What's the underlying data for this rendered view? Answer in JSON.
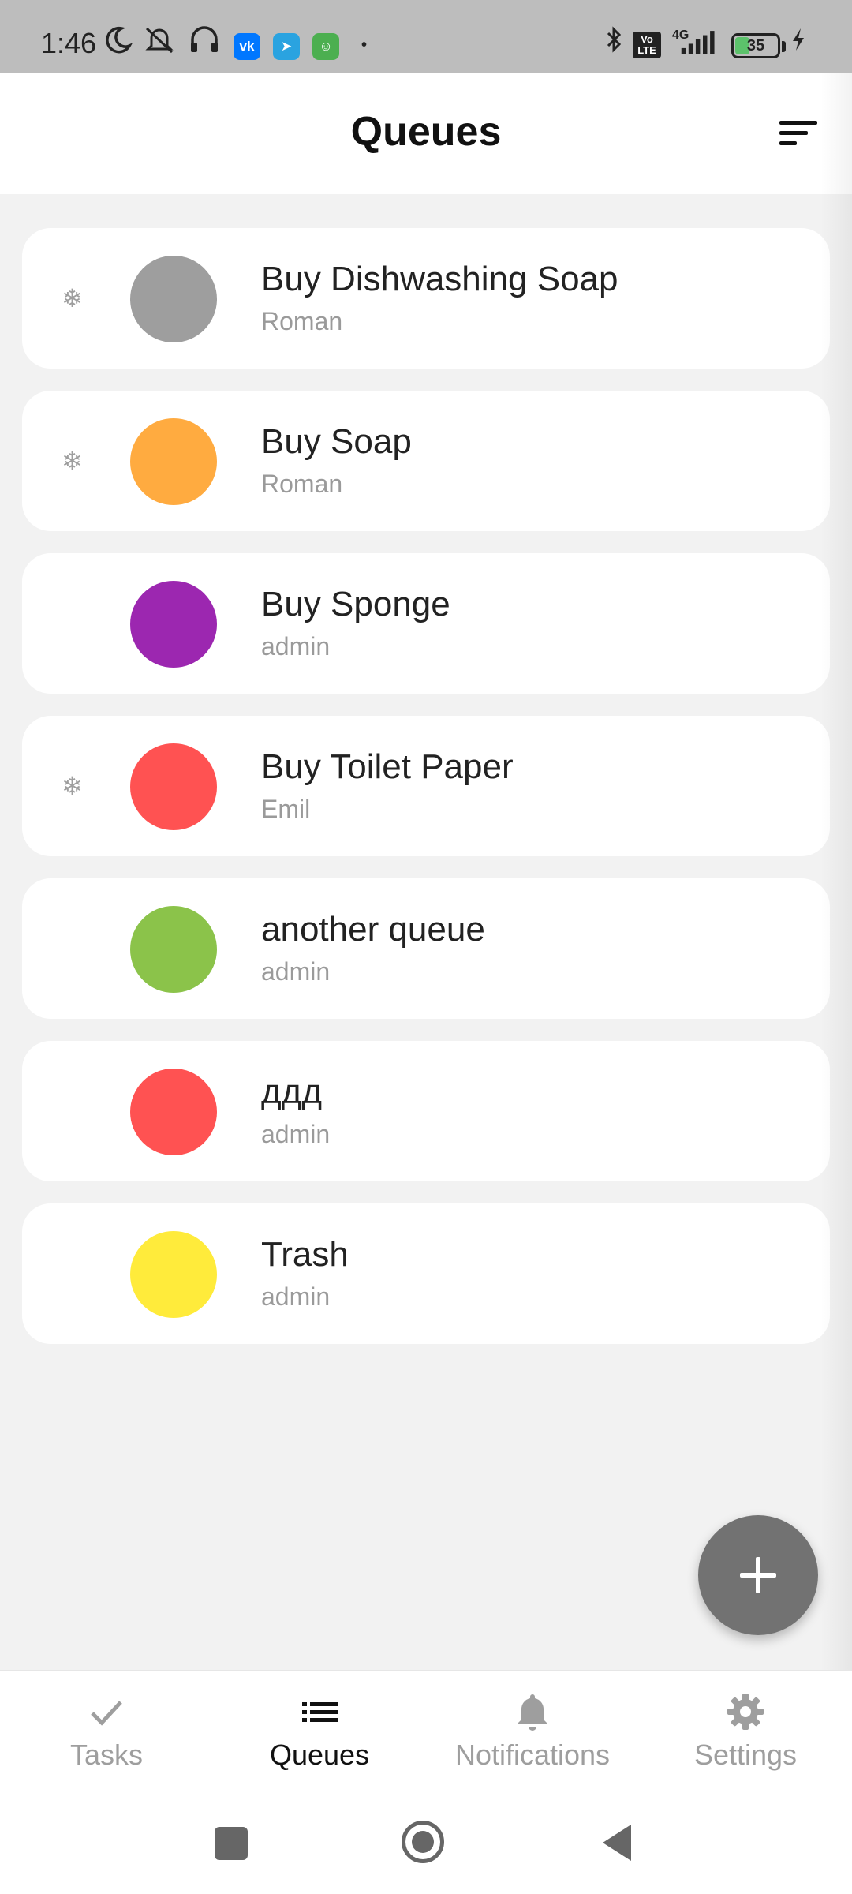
{
  "status_bar": {
    "time": "1:46",
    "apps": [
      {
        "name": "vk-icon",
        "glyph": "vk",
        "color": "#0077ff"
      },
      {
        "name": "telegram-icon",
        "glyph": "➤",
        "color": "#2aa3e0"
      },
      {
        "name": "bot-icon",
        "glyph": "☺",
        "color": "#4caf50"
      }
    ],
    "volte": "Vo LTE",
    "network": "4G",
    "battery": {
      "level": 35,
      "label": "35"
    }
  },
  "header": {
    "title": "Queues",
    "sort_icon": "sort-icon"
  },
  "queues": [
    {
      "name": "Buy Dishwashing Soap",
      "owner": "Roman",
      "color": "#9e9e9e",
      "frozen": true
    },
    {
      "name": "Buy Soap",
      "owner": "Roman",
      "color": "#ffab40",
      "frozen": true
    },
    {
      "name": "Buy Sponge",
      "owner": "admin",
      "color": "#9c27b0",
      "frozen": false
    },
    {
      "name": "Buy Toilet Paper",
      "owner": "Emil",
      "color": "#ff5252",
      "frozen": true
    },
    {
      "name": "another queue",
      "owner": "admin",
      "color": "#8bc34a",
      "frozen": false
    },
    {
      "name": "ддд",
      "owner": "admin",
      "color": "#ff5252",
      "frozen": false
    },
    {
      "name": "Trash",
      "owner": "admin",
      "color": "#ffeb3b",
      "frozen": false
    }
  ],
  "freeze_glyph": "❄",
  "fab": {
    "icon": "plus-icon"
  },
  "bottom_nav": {
    "active": "Queues",
    "items": [
      {
        "label": "Tasks",
        "icon": "check-icon"
      },
      {
        "label": "Queues",
        "icon": "list-icon"
      },
      {
        "label": "Notifications",
        "icon": "bell-icon"
      },
      {
        "label": "Settings",
        "icon": "gear-icon"
      }
    ]
  },
  "colors": {
    "accent": "#727272",
    "background": "#f2f2f2",
    "card": "#ffffff"
  }
}
